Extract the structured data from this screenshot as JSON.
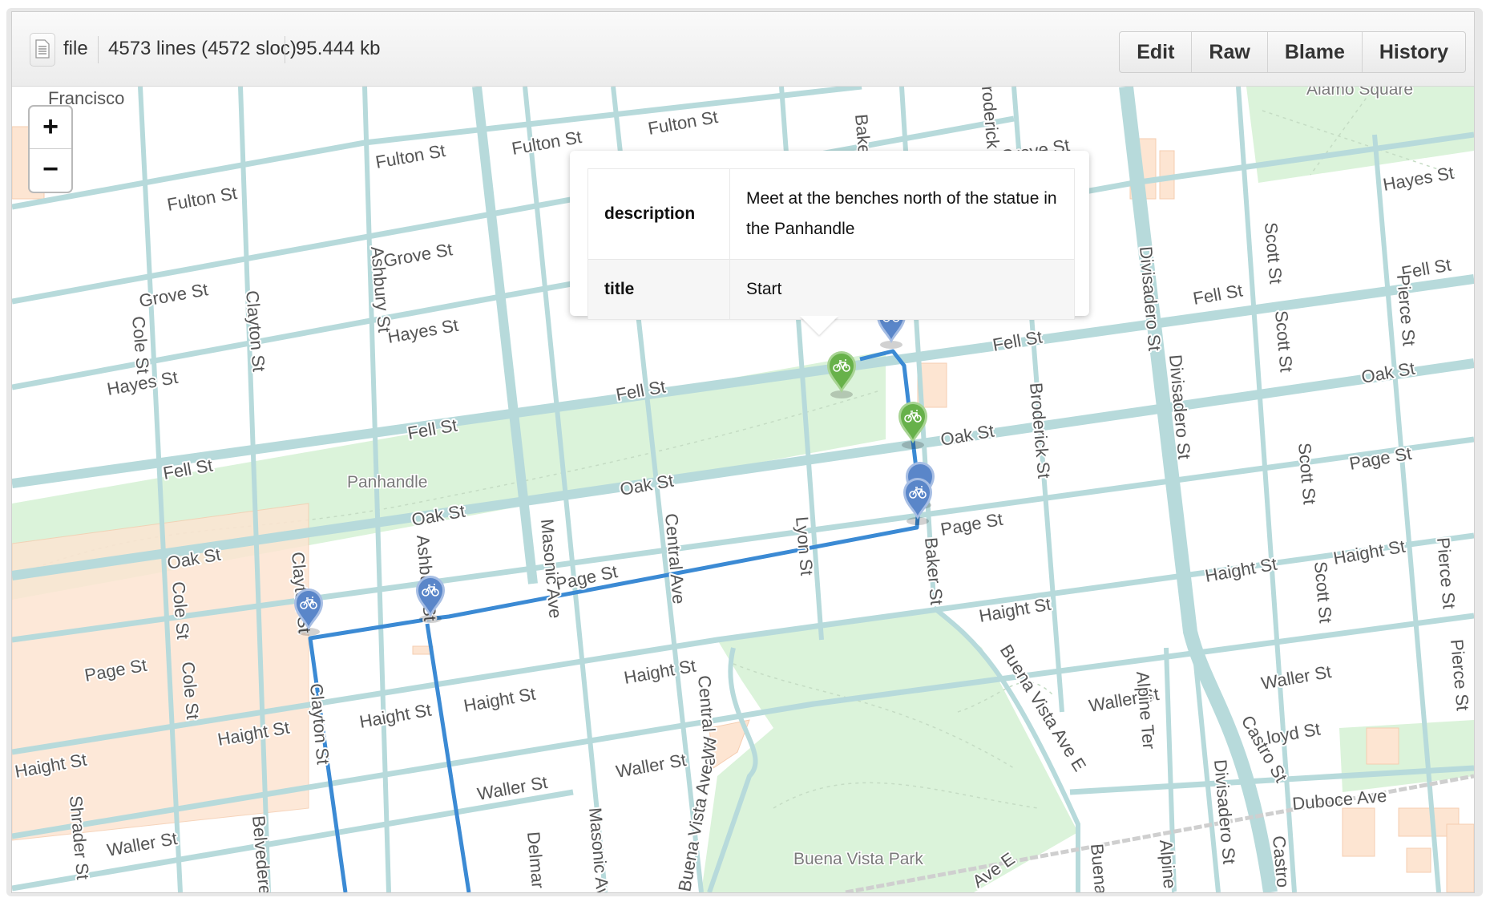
{
  "file_header": {
    "icon": "file-text-icon",
    "mode": "file",
    "lines": "4573 lines (4572 sloc)",
    "size": "95.444 kb",
    "buttons": [
      "Edit",
      "Raw",
      "Blame",
      "History"
    ]
  },
  "map": {
    "zoom_in_label": "+",
    "zoom_out_label": "−",
    "colors": {
      "street": "#b7dadb",
      "park": "#dbf3da",
      "building": "#fde5d2",
      "route": "#3b8ad4",
      "marker_blue": "#5a86c9",
      "marker_green": "#67b14a"
    },
    "place_labels": [
      "Francisco",
      "Panhandle",
      "Buena Vista Park",
      "Alamo Square"
    ],
    "street_labels": [
      "Fulton St",
      "Fulton St",
      "Fulton St",
      "Fulton St",
      "Fulton St",
      "Grove St",
      "Grove St",
      "Grove St",
      "Hayes St",
      "Hayes St",
      "Hayes St",
      "Fell St",
      "Fell St",
      "Fell St",
      "Fell St",
      "Fell St",
      "Fell St",
      "Oak St",
      "Oak St",
      "Oak St",
      "Oak St",
      "Oak St",
      "Page St",
      "Page St",
      "Page St",
      "Page St",
      "Haight St",
      "Haight St",
      "Haight St",
      "Haight St",
      "Haight St",
      "Haight St",
      "Haight St",
      "Haight St",
      "Haight St",
      "Waller St",
      "Waller St",
      "Waller St",
      "Waller St",
      "Waller St",
      "Lloyd St",
      "Duboce Ave",
      "Cole St",
      "Cole St",
      "Cole St",
      "Clayton St",
      "Clayton St",
      "Clayton St",
      "Ashbury St",
      "Ashbury St",
      "Masonic Ave",
      "Masonic Ave",
      "Central Ave",
      "Central Ave",
      "Lyon St",
      "Baker St",
      "Baker",
      "Broderick St",
      "roderick",
      "Divisadero St",
      "Divisadero St",
      "Divisadero St",
      "Scott St",
      "Scott St",
      "Scott St",
      "Scott St",
      "Pierce St",
      "Pierce St",
      "Pierce St",
      "Buena Vista Ave E",
      "Buena Vista Ave W",
      "Ave E",
      "Alpine Ter",
      "Alpine Ter",
      "Castro St",
      "Castro St",
      "Shrader St",
      "Belvedere",
      "Delmar St",
      "Buena"
    ],
    "markers": [
      {
        "color": "green",
        "icon": "bicycle-icon",
        "title": "Start"
      },
      {
        "color": "blue",
        "icon": "bicycle-icon"
      },
      {
        "color": "green",
        "icon": "bicycle-icon"
      },
      {
        "color": "blue",
        "icon": "bicycle-icon"
      },
      {
        "color": "blue",
        "icon": "bicycle-icon"
      },
      {
        "color": "blue",
        "icon": "bicycle-icon"
      },
      {
        "color": "blue",
        "icon": "bicycle-icon"
      }
    ],
    "popup": {
      "rows": [
        {
          "key": "description",
          "value": "Meet at the benches north of the statue in the Panhandle"
        },
        {
          "key": "title",
          "value": "Start"
        }
      ]
    }
  }
}
